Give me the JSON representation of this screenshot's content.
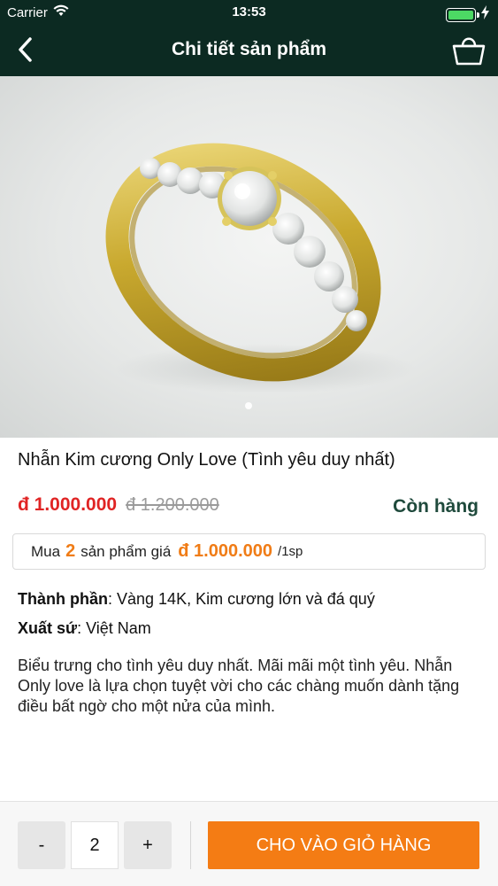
{
  "status_bar": {
    "carrier": "Carrier",
    "time": "13:53"
  },
  "nav": {
    "title": "Chi tiết sản phẩm",
    "back_icon": "chevron-left-icon",
    "cart_icon": "shopping-basket-icon"
  },
  "gallery": {
    "image_description": "gold-diamond-ring",
    "pages": 1,
    "active_page": 1
  },
  "product": {
    "name": "Nhẫn Kim cương Only Love (Tình yêu duy nhất)",
    "currency_symbol": "đ",
    "price": "1.000.000",
    "old_price": "đ 1.200.000",
    "stock_status": "Còn hàng"
  },
  "bulk_offer": {
    "prefix": "Mua",
    "quantity": "2",
    "middle": "sản phẩm giá",
    "price": "đ 1.000.000",
    "unit": "/1sp"
  },
  "attributes": [
    {
      "label": "Thành phần",
      "value": ": Vàng 14K, Kim cương lớn và đá quý"
    },
    {
      "label": "Xuất sứ",
      "value": ": Việt Nam"
    }
  ],
  "description": "Biểu trưng cho tình yêu duy nhất. Mãi mãi một tình yêu. Nhẫn Only love là lựa chọn tuyệt vời cho các chàng muốn dành tặng điều bất ngờ cho một nửa của mình.",
  "cart_bar": {
    "minus_label": "-",
    "quantity": "2",
    "plus_label": "+",
    "add_to_cart_label": "CHO VÀO GIỎ HÀNG"
  },
  "colors": {
    "header_bg": "#0c2a22",
    "price_red": "#e02424",
    "accent_orange": "#f47c14",
    "stock_green": "#1f4a3c"
  }
}
